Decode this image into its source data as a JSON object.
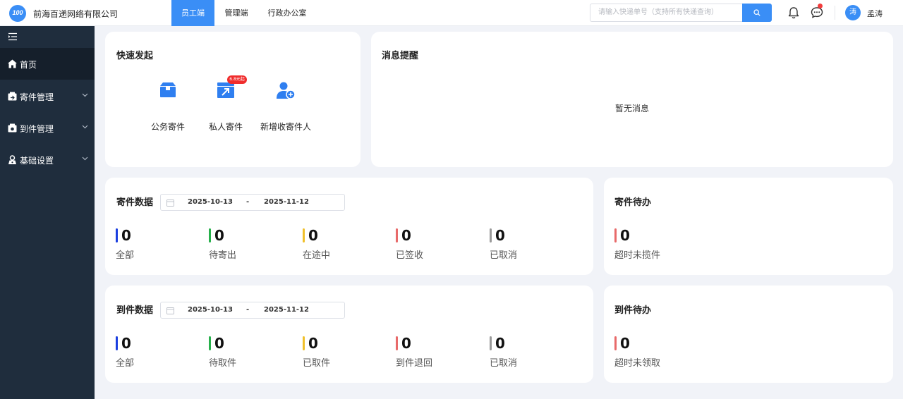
{
  "header": {
    "company": "前海百递网络有限公司",
    "tabs": [
      {
        "label": "员工端",
        "active": true
      },
      {
        "label": "管理端",
        "active": false
      },
      {
        "label": "行政办公室",
        "active": false
      }
    ],
    "search_placeholder": "请输入快递单号（支持所有快递查询）",
    "avatar_text": "涛",
    "username": "孟涛",
    "accent_color": "#3a8ef6"
  },
  "sidebar": {
    "items": [
      {
        "label": "首页",
        "icon": "home-icon",
        "active": true
      },
      {
        "label": "寄件管理",
        "icon": "send-package-icon",
        "expandable": true
      },
      {
        "label": "到件管理",
        "icon": "receive-package-icon",
        "expandable": true
      },
      {
        "label": "基础设置",
        "icon": "settings-lock-icon",
        "expandable": true
      }
    ]
  },
  "quick_start": {
    "title": "快速发起",
    "items": [
      {
        "label": "公务寄件",
        "icon": "box-icon"
      },
      {
        "label": "私人寄件",
        "icon": "send-arrow-icon",
        "badge": "6.8元起"
      },
      {
        "label": "新增收寄件人",
        "icon": "add-contact-icon"
      }
    ]
  },
  "messages": {
    "title": "消息提醒",
    "empty_text": "暂无消息"
  },
  "send_data": {
    "title": "寄件数据",
    "date_start": "2025-10-13",
    "date_sep": "-",
    "date_end": "2025-11-12",
    "stats": [
      {
        "value": "0",
        "label": "全部",
        "color": "#1b3fe0"
      },
      {
        "value": "0",
        "label": "待寄出",
        "color": "#27b04b"
      },
      {
        "value": "0",
        "label": "在途中",
        "color": "#f0c02b"
      },
      {
        "value": "0",
        "label": "已签收",
        "color": "#e86a6a"
      },
      {
        "value": "0",
        "label": "已取消",
        "color": "#9a9a9a"
      }
    ]
  },
  "send_todo": {
    "title": "寄件待办",
    "stats": [
      {
        "value": "0",
        "label": "超时未揽件",
        "color": "#e86a6a"
      }
    ]
  },
  "receive_data": {
    "title": "到件数据",
    "date_start": "2025-10-13",
    "date_sep": "-",
    "date_end": "2025-11-12",
    "stats": [
      {
        "value": "0",
        "label": "全部",
        "color": "#1b3fe0"
      },
      {
        "value": "0",
        "label": "待取件",
        "color": "#27b04b"
      },
      {
        "value": "0",
        "label": "已取件",
        "color": "#f0c02b"
      },
      {
        "value": "0",
        "label": "到件退回",
        "color": "#e86a6a"
      },
      {
        "value": "0",
        "label": "已取消",
        "color": "#9a9a9a"
      }
    ]
  },
  "receive_todo": {
    "title": "到件待办",
    "stats": [
      {
        "value": "0",
        "label": "超时未领取",
        "color": "#e86a6a"
      }
    ]
  }
}
